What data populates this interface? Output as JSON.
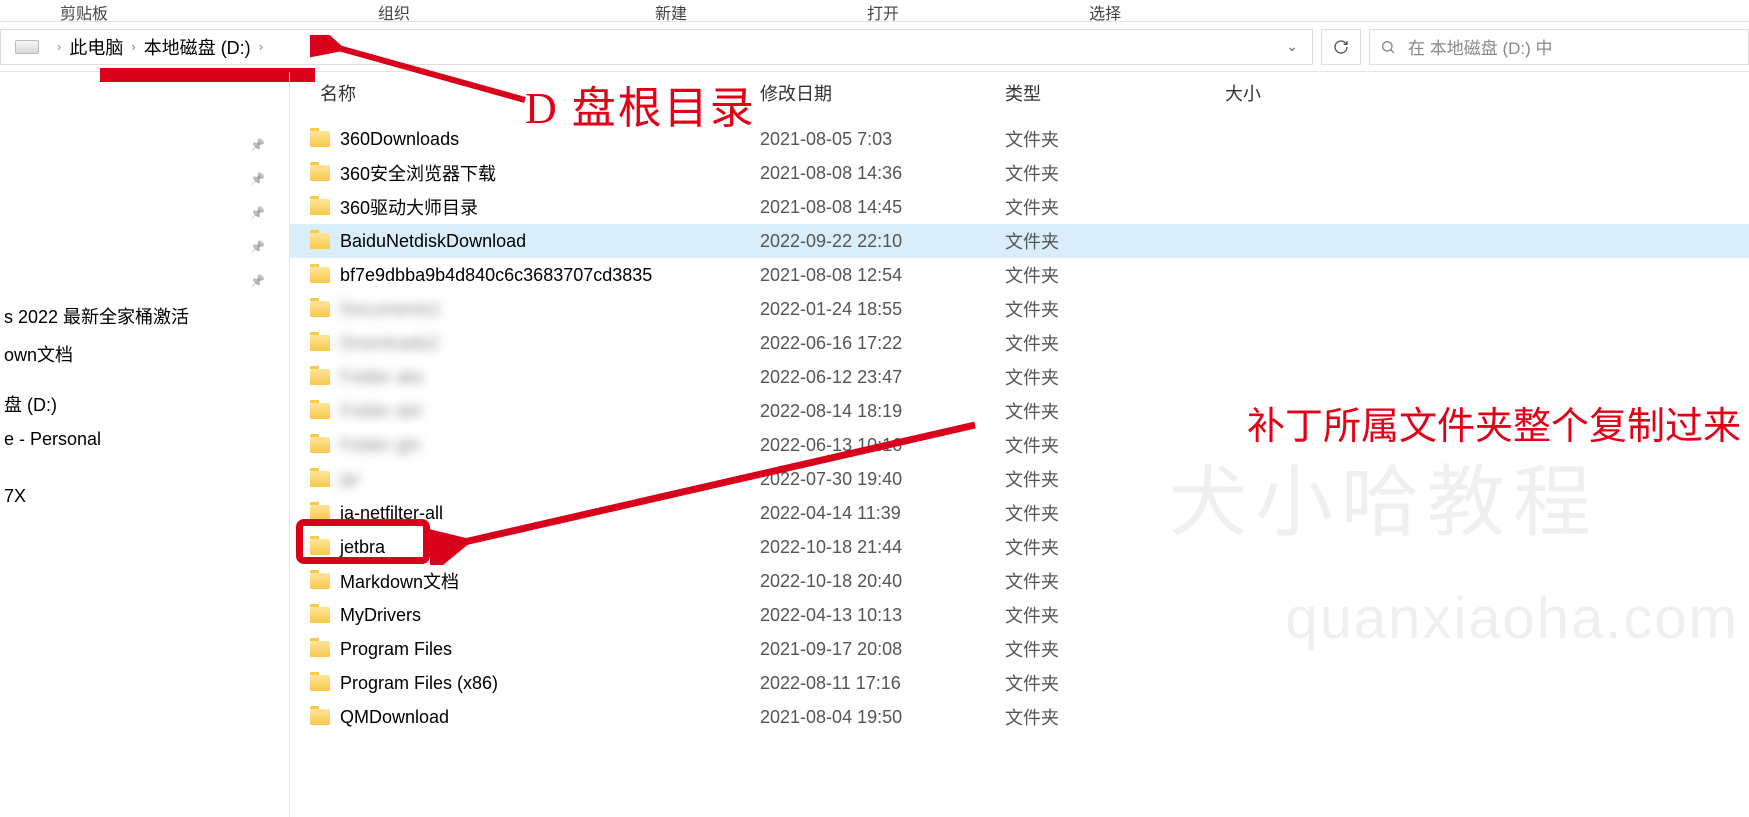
{
  "ribbon": {
    "clipboard": "剪贴板",
    "organize": "组织",
    "new": "新建",
    "open": "打开",
    "select": "选择"
  },
  "breadcrumb": {
    "this_pc": "此电脑",
    "drive": "本地磁盘 (D:)"
  },
  "search": {
    "placeholder": "在 本地磁盘 (D:) 中"
  },
  "columns": {
    "name": "名称",
    "date": "修改日期",
    "type": "类型",
    "size": "大小"
  },
  "folder_type": "文件夹",
  "files": [
    {
      "name": "360Downloads",
      "date": "2021-08-05 7:03",
      "blur": false
    },
    {
      "name": "360安全浏览器下载",
      "date": "2021-08-08 14:36",
      "blur": false
    },
    {
      "name": "360驱动大师目录",
      "date": "2021-08-08 14:45",
      "blur": false
    },
    {
      "name": "BaiduNetdiskDownload",
      "date": "2022-09-22 22:10",
      "blur": false,
      "selected": true
    },
    {
      "name": "bf7e9dbba9b4d840c6c3683707cd3835",
      "date": "2021-08-08 12:54",
      "blur": false
    },
    {
      "name": "Documents1",
      "date": "2022-01-24 18:55",
      "blur": true
    },
    {
      "name": "Downloads2",
      "date": "2022-06-16 17:22",
      "blur": true
    },
    {
      "name": "Folder abc",
      "date": "2022-06-12 23:47",
      "blur": true
    },
    {
      "name": "Folder def",
      "date": "2022-08-14 18:19",
      "blur": true
    },
    {
      "name": "Folder ghi",
      "date": "2022-06-13 10:16",
      "blur": true
    },
    {
      "name": "jar",
      "date": "2022-07-30 19:40",
      "blur": true
    },
    {
      "name": "ja-netfilter-all",
      "date": "2022-04-14 11:39",
      "blur": false
    },
    {
      "name": "jetbra",
      "date": "2022-10-18 21:44",
      "blur": false
    },
    {
      "name": "Markdown文档",
      "date": "2022-10-18 20:40",
      "blur": false
    },
    {
      "name": "MyDrivers",
      "date": "2022-04-13 10:13",
      "blur": false
    },
    {
      "name": "Program Files",
      "date": "2021-09-17 20:08",
      "blur": false
    },
    {
      "name": "Program Files (x86)",
      "date": "2022-08-11 17:16",
      "blur": false
    },
    {
      "name": "QMDownload",
      "date": "2021-08-04 19:50",
      "blur": false
    }
  ],
  "sidebar": {
    "items": [
      "s  2022 最新全家桶激活",
      "own文档",
      "",
      "盘 (D:)",
      "e - Personal",
      "",
      "",
      "7X",
      ""
    ]
  },
  "annotations": {
    "root_label": "D 盘根目录",
    "copy_label": "补丁所属文件夹整个复制过来"
  },
  "watermark": {
    "line1": "犬小哈教程",
    "line2": "quanxiaoha.com"
  }
}
